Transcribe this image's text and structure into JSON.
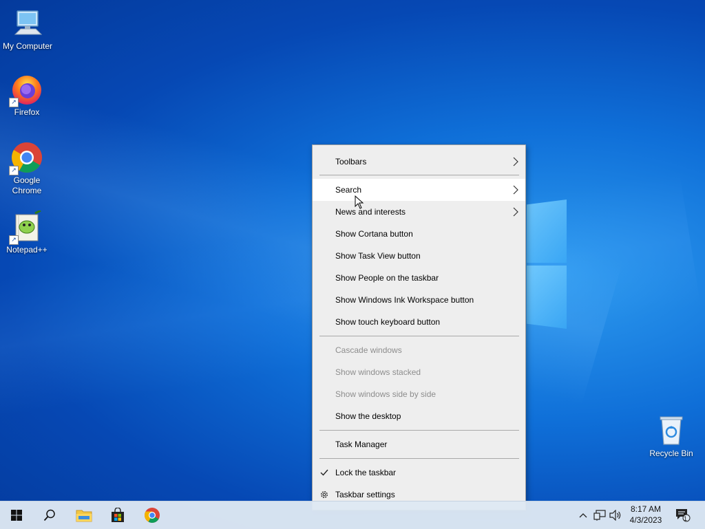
{
  "desktop": {
    "icons": [
      {
        "label": "My Computer",
        "icon": "monitor-icon"
      },
      {
        "label": "Firefox",
        "icon": "firefox-icon"
      },
      {
        "label": "Google Chrome",
        "icon": "chrome-icon"
      },
      {
        "label": "Notepad++",
        "icon": "notepadpp-icon"
      },
      {
        "label": "Recycle Bin",
        "icon": "recycle-bin-icon"
      }
    ]
  },
  "context_menu": {
    "items": [
      {
        "label": "Toolbars",
        "submenu": true
      },
      {
        "label": "Search",
        "submenu": true
      },
      {
        "label": "News and interests",
        "submenu": true
      },
      {
        "label": "Show Cortana button"
      },
      {
        "label": "Show Task View button"
      },
      {
        "label": "Show People on the taskbar"
      },
      {
        "label": "Show Windows Ink Workspace button"
      },
      {
        "label": "Show touch keyboard button"
      },
      {
        "label": "Cascade windows",
        "disabled": true
      },
      {
        "label": "Show windows stacked",
        "disabled": true
      },
      {
        "label": "Show windows side by side",
        "disabled": true
      },
      {
        "label": "Show the desktop"
      },
      {
        "label": "Task Manager"
      },
      {
        "label": "Lock the taskbar",
        "checked": true
      },
      {
        "label": "Taskbar settings",
        "icon": "gear-icon"
      }
    ],
    "hovered": "Search"
  },
  "taskbar": {
    "pinned": [
      "start-icon",
      "search-icon",
      "file-explorer-icon",
      "store-icon",
      "chrome-icon"
    ],
    "clock": {
      "time": "8:17 AM",
      "date": "4/3/2023"
    },
    "notification_count": "1"
  },
  "colors": {
    "menu_bg": "#eeeeee",
    "menu_hover": "#ffffff",
    "disabled_text": "#8d8d8d",
    "taskbar_bg": "#dee8f2",
    "desktop_blue": "#0f6fd8"
  }
}
